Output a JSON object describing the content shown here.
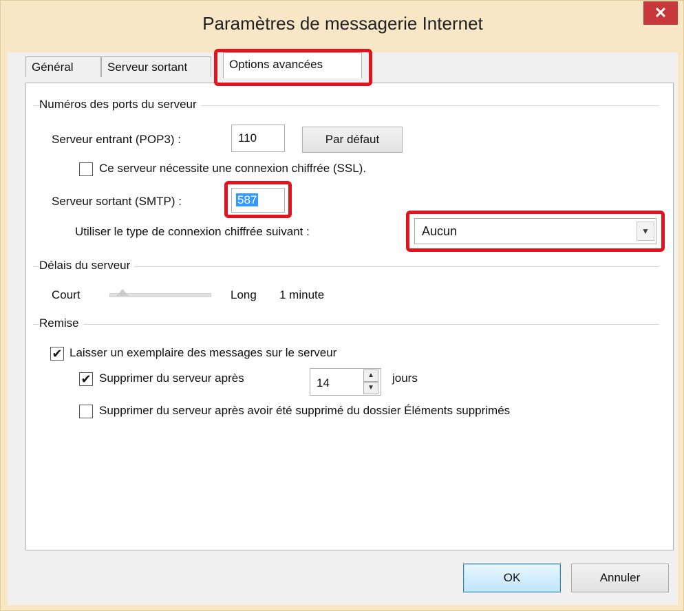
{
  "window": {
    "title": "Paramètres de messagerie Internet",
    "close_glyph": "✕"
  },
  "tabs": [
    {
      "label": "Général"
    },
    {
      "label": "Serveur sortant"
    },
    {
      "label": "Options avancées",
      "active": true
    }
  ],
  "ports": {
    "group_label": "Numéros des ports du serveur",
    "incoming_label": "Serveur entrant (POP3) :",
    "incoming_value": "110",
    "default_button": "Par défaut",
    "ssl_checkbox_label": "Ce serveur nécessite une connexion chiffrée (SSL).",
    "ssl_checked": false,
    "outgoing_label": "Serveur sortant (SMTP) :",
    "outgoing_value": "587",
    "encryption_label": "Utiliser le type de connexion chiffrée suivant :",
    "encryption_value": "Aucun"
  },
  "timeouts": {
    "group_label": "Délais du serveur",
    "short_label": "Court",
    "long_label": "Long",
    "value_text": "1 minute",
    "slider_level": 0.13
  },
  "delivery": {
    "group_label": "Remise",
    "leave_copy_label": "Laisser un exemplaire des messages sur le serveur",
    "leave_copy_checked": true,
    "remove_after_label": "Supprimer du serveur après",
    "remove_after_checked": true,
    "days_value": "14",
    "days_unit": "jours",
    "remove_deleted_label": "Supprimer du serveur après avoir été supprimé du dossier Éléments supprimés",
    "remove_deleted_checked": false
  },
  "footer": {
    "ok": "OK",
    "cancel": "Annuler"
  },
  "colors": {
    "highlight": "#e0141e",
    "title_bg": "#f7e7c6",
    "close_bg": "#c7383c",
    "selection": "#3399ff"
  },
  "icons": {
    "close": "close-icon",
    "dropdown": "chevron-down-icon",
    "check": "checkmark-icon"
  }
}
